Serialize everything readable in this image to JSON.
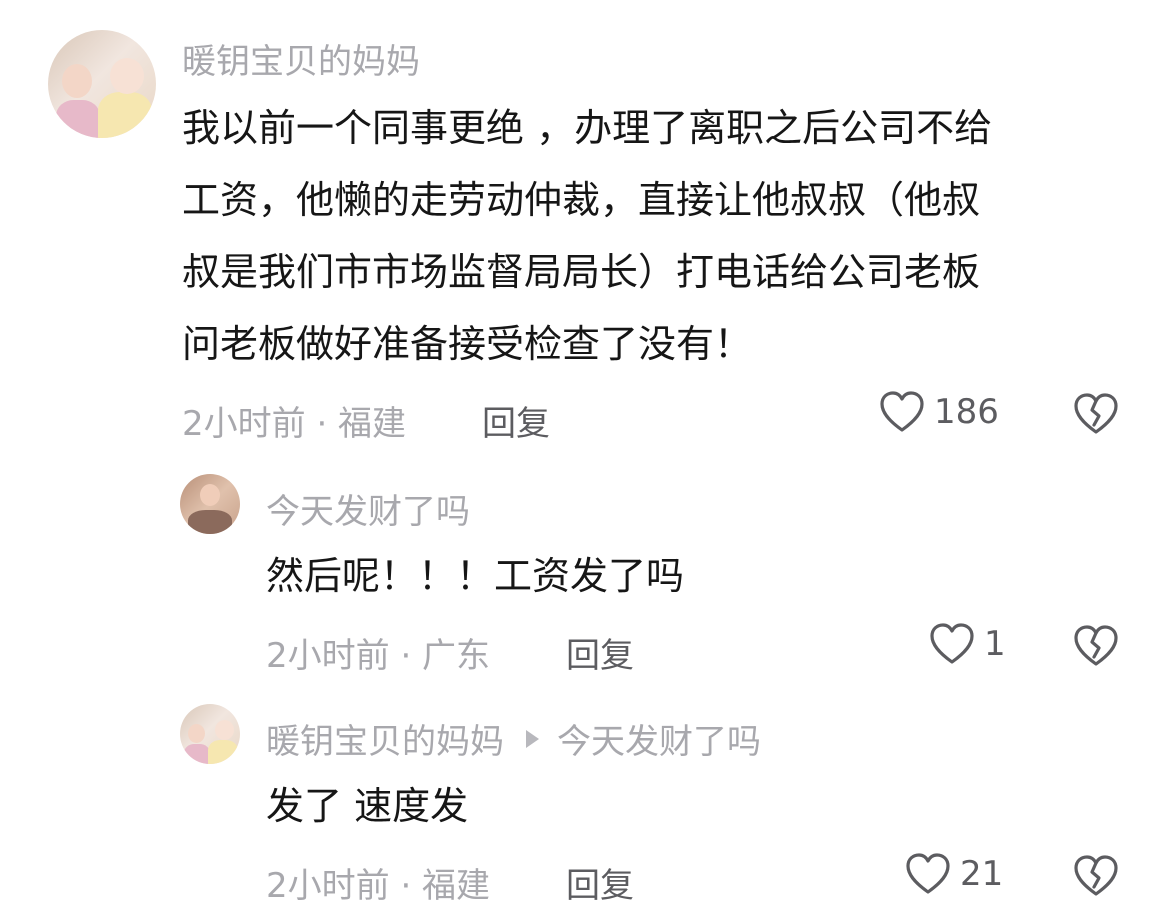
{
  "comments": [
    {
      "username": "暖钥宝贝的妈妈",
      "text": "我以前一个同事更绝 ，办理了离职之后公司不给工资，他懒的走劳动仲裁，直接让他叔叔（他叔叔是我们市市场监督局局长）打电话给公司老板问老板做好准备接受检查了没有！",
      "lines": [
        "我以前一个同事更绝 ，办理了离职之后公司不给",
        "工资，他懒的走劳动仲裁，直接让他叔叔（他叔",
        "叔是我们市市场监督局局长）打电话给公司老板",
        "问老板做好准备接受检查了没有！"
      ],
      "meta": "2小时前 · 福建",
      "reply_label": "回复",
      "likes": "186"
    },
    {
      "username": "今天发财了吗",
      "text": "然后呢！！！工资发了吗",
      "meta": "2小时前 · 广东",
      "reply_label": "回复",
      "likes": "1"
    },
    {
      "username": "暖钥宝贝的妈妈",
      "reply_to": "今天发财了吗",
      "text": "发了 速度发",
      "meta": "2小时前 · 福建",
      "reply_label": "回复",
      "likes": "21"
    }
  ],
  "icons": {
    "like": "heart-outline-icon",
    "dislike": "broken-heart-icon",
    "reply_arrow": "triangle-right-icon"
  },
  "colors": {
    "text": "#161616",
    "secondary": "#a8a8ad",
    "action": "#5c5c60"
  }
}
